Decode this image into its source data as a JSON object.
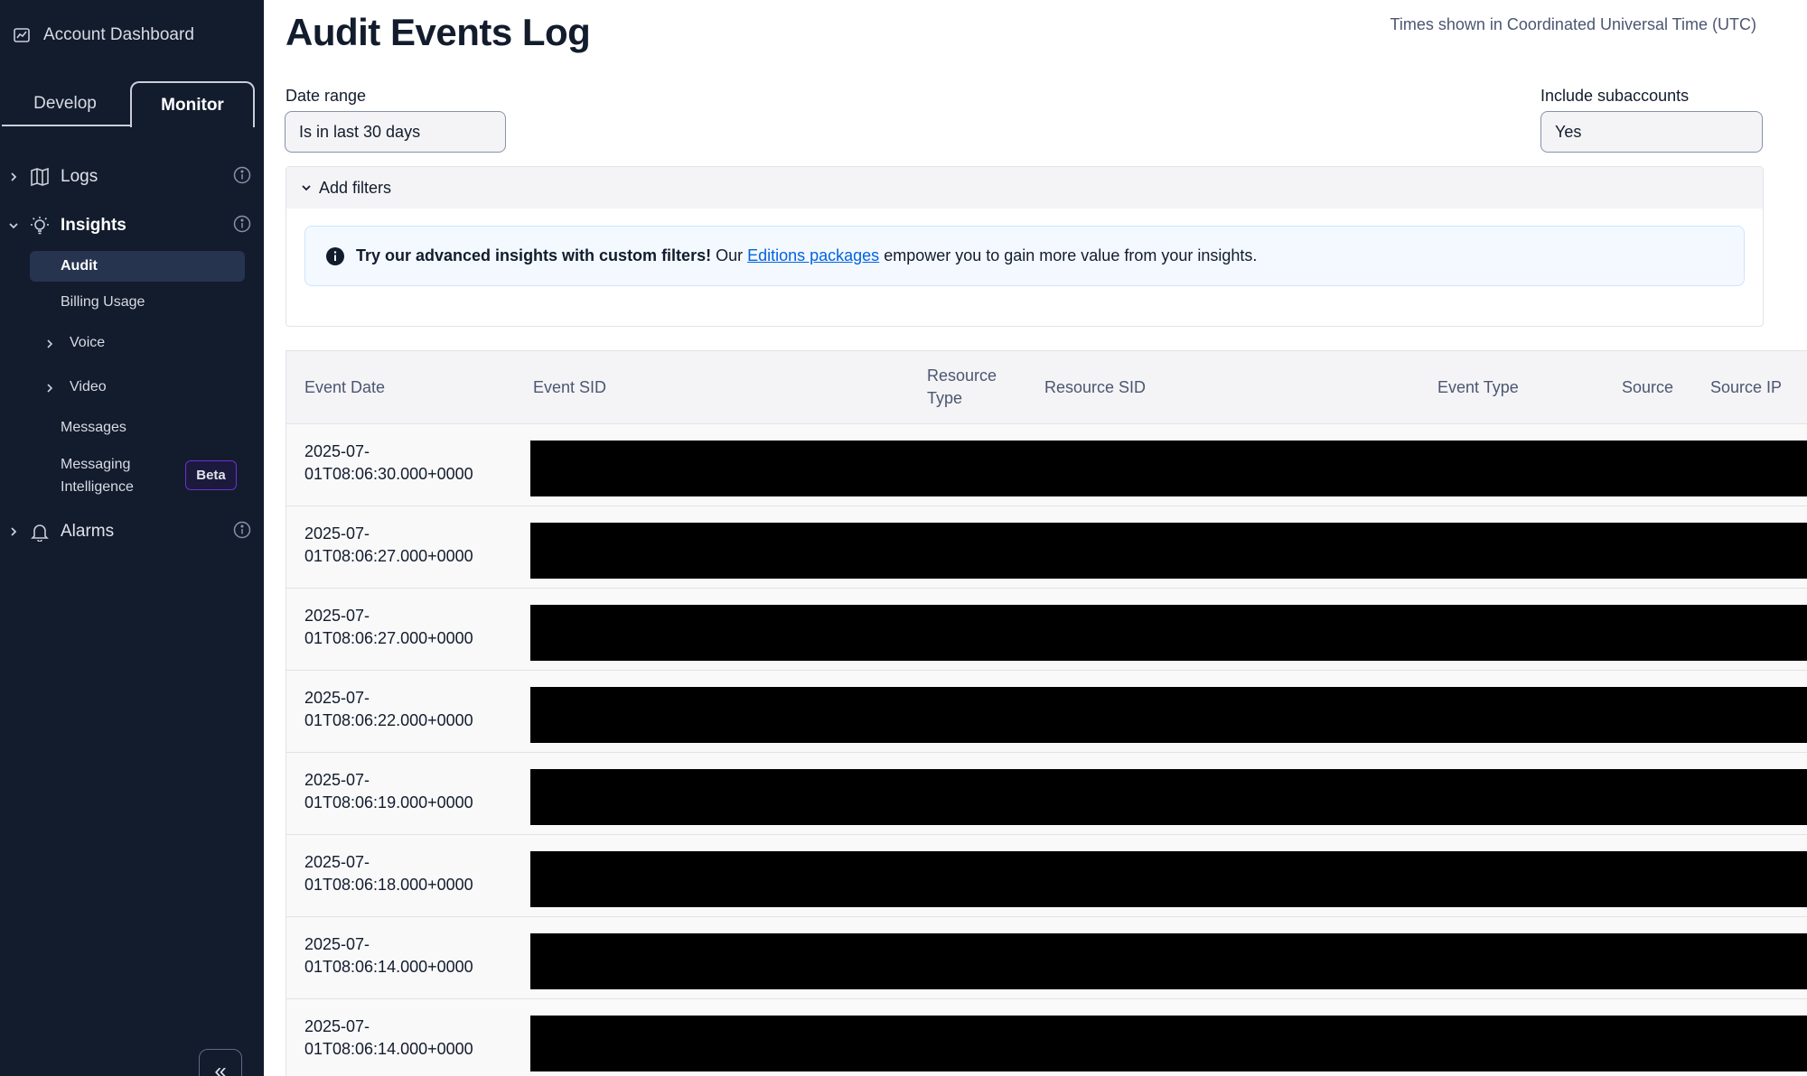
{
  "sidebar": {
    "account_label": "Account Dashboard",
    "tabs": [
      {
        "label": "Develop",
        "active": false
      },
      {
        "label": "Monitor",
        "active": true
      }
    ],
    "sections": {
      "logs": "Logs",
      "insights": "Insights",
      "alarms": "Alarms"
    },
    "insights_items": {
      "audit": "Audit",
      "billing_usage": "Billing Usage",
      "voice": "Voice",
      "video": "Video",
      "messages": "Messages",
      "messaging_intelligence_line1": "Messaging",
      "messaging_intelligence_line2": "Intelligence",
      "beta_badge": "Beta"
    },
    "collapse_icon": "«"
  },
  "main": {
    "title": "Audit Events Log",
    "timezone_note": "Times shown in Coordinated Universal Time (UTC)",
    "date_range": {
      "label": "Date range",
      "value": "Is in last 30 days"
    },
    "subaccounts": {
      "label": "Include subaccounts",
      "value": "Yes"
    },
    "filters": {
      "toggle_label": "Add filters",
      "notice_bold": "Try our advanced insights with custom filters!",
      "notice_pre_link": " Our ",
      "notice_link": "Editions packages",
      "notice_post_link": " empower you to gain more value from your insights."
    },
    "table": {
      "headers": {
        "event_date": "Event Date",
        "event_sid": "Event SID",
        "resource_type_1": "Resource",
        "resource_type_2": "Type",
        "resource_sid": "Resource SID",
        "event_type": "Event Type",
        "source": "Source",
        "source_ip": "Source IP"
      },
      "rows": [
        {
          "date_1": "2025-07-",
          "date_2": "01T08:06:30.000+0000"
        },
        {
          "date_1": "2025-07-",
          "date_2": "01T08:06:27.000+0000"
        },
        {
          "date_1": "2025-07-",
          "date_2": "01T08:06:27.000+0000"
        },
        {
          "date_1": "2025-07-",
          "date_2": "01T08:06:22.000+0000"
        },
        {
          "date_1": "2025-07-",
          "date_2": "01T08:06:19.000+0000"
        },
        {
          "date_1": "2025-07-",
          "date_2": "01T08:06:18.000+0000"
        },
        {
          "date_1": "2025-07-",
          "date_2": "01T08:06:14.000+0000"
        },
        {
          "date_1": "2025-07-",
          "date_2": "01T08:06:14.000+0000"
        }
      ]
    }
  },
  "colors": {
    "sidebar_bg": "#121c2d",
    "active_item_bg": "#263450",
    "link": "#0263e0",
    "beta_border": "#6d2ed1",
    "notice_bg": "#f4f9ff",
    "redaction": "#000000"
  }
}
